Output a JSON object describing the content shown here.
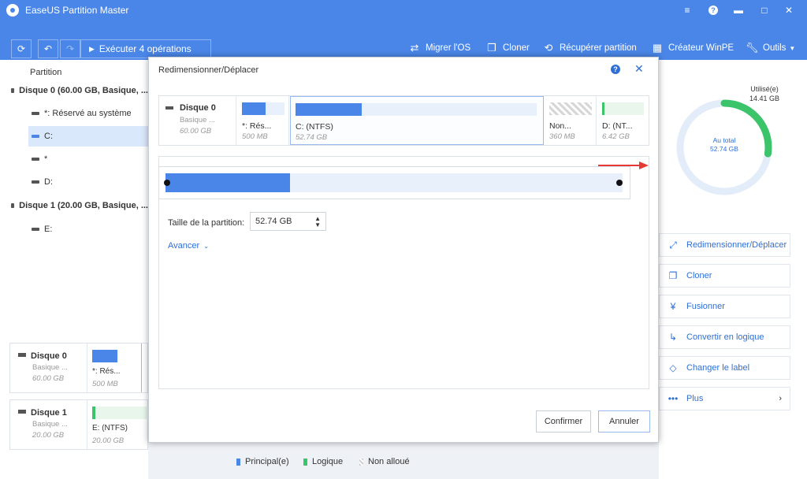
{
  "app": {
    "title": "EaseUS Partition Master"
  },
  "toolbar": {
    "execute_label": "Exécuter 4 opérations",
    "items": [
      {
        "label": "Migrer l'OS",
        "icon": "migrate-icon"
      },
      {
        "label": "Cloner",
        "icon": "clone-icon"
      },
      {
        "label": "Récupérer partition",
        "icon": "recover-icon"
      },
      {
        "label": "Créateur WinPE",
        "icon": "winpe-icon"
      },
      {
        "label": "Outils",
        "icon": "tools-icon"
      }
    ]
  },
  "tree": {
    "header": "Partition",
    "disk0": "Disque 0 (60.00 GB, Basique, ...",
    "p_reserve": "*: Réservé au système",
    "p_c": "C:",
    "p_star": "*",
    "p_d": "D:",
    "disk1": "Disque 1 (20.00 GB, Basique, ...",
    "p_e": "E:"
  },
  "bottom": {
    "disk0": {
      "name": "Disque 0",
      "type": "Basique ...",
      "size": "60.00 GB",
      "part_label": "*: Rés...",
      "part_size": "500 MB"
    },
    "disk1": {
      "name": "Disque 1",
      "type": "Basique ...",
      "size": "20.00 GB",
      "part_label": "E: (NTFS)",
      "part_size": "20.00 GB"
    }
  },
  "legend": {
    "primary": "Principal(e)",
    "logical": "Logique",
    "unallocated": "Non alloué"
  },
  "usage": {
    "used_label": "Utilisé(e)",
    "used_value": "14.41 GB",
    "total_label": "Au total",
    "total_value": "52.74 GB",
    "used_fraction": 0.273
  },
  "actions": [
    {
      "label": "Redimensionner/Déplacer",
      "icon": "resize-icon"
    },
    {
      "label": "Cloner",
      "icon": "clone-icon"
    },
    {
      "label": "Fusionner",
      "icon": "merge-icon"
    },
    {
      "label": "Convertir en logique",
      "icon": "convert-icon"
    },
    {
      "label": "Changer le label",
      "icon": "label-icon"
    },
    {
      "label": "Plus",
      "icon": "more-icon"
    }
  ],
  "dialog": {
    "title": "Redimensionner/Déplacer",
    "disk": {
      "name": "Disque 0",
      "type": "Basique ...",
      "size": "60.00 GB"
    },
    "partitions": [
      {
        "label": "*: Rés...",
        "size": "500 MB"
      },
      {
        "label": "C: (NTFS)",
        "size": "52.74 GB"
      },
      {
        "label": "Non...",
        "size": "360 MB"
      },
      {
        "label": "D: (NT...",
        "size": "6.42 GB"
      }
    ],
    "partition_size_label": "Taille de la partition:",
    "partition_size_value": "52.74 GB",
    "advanced_label": "Avancer",
    "confirm_label": "Confirmer",
    "cancel_label": "Annuler",
    "slider_used_fraction": 0.273
  },
  "colors": {
    "brand": "#4a86e8",
    "accent": "#2e6fd6",
    "used_ring": "#3cc46a",
    "logical": "#3cc46a"
  }
}
